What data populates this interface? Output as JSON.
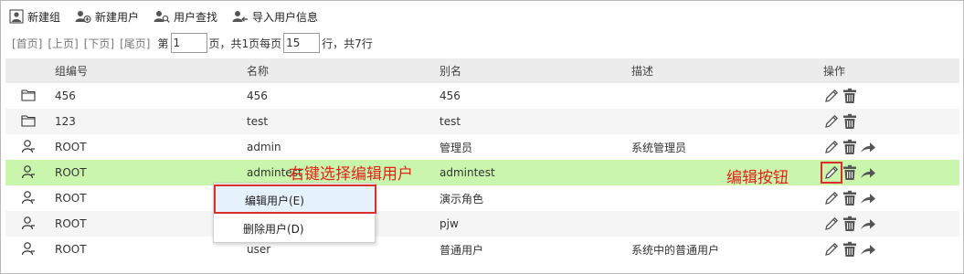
{
  "toolbar": {
    "new_group": "新建组",
    "new_user": "新建用户",
    "search_user": "用户查找",
    "import_user": "导入用户信息"
  },
  "pager": {
    "first": "[首页]",
    "prev": "[上页]",
    "next": "[下页]",
    "last": "[尾页]",
    "page_prefix": "第",
    "page_value": "1",
    "page_suffix": "页，共1页每页",
    "per_page_value": "15",
    "total_text": "行，共7行"
  },
  "table": {
    "headers": [
      "组编号",
      "名称",
      "别名",
      "描述",
      "操作"
    ],
    "rows": [
      {
        "type": "group",
        "id": "456",
        "name": "456",
        "alias": "456",
        "desc": ""
      },
      {
        "type": "group",
        "id": "123",
        "name": "test",
        "alias": "test",
        "desc": ""
      },
      {
        "type": "user",
        "id": "ROOT",
        "name": "admin",
        "alias": "管理员",
        "desc": "系统管理员"
      },
      {
        "type": "user",
        "id": "ROOT",
        "name": "admintest",
        "alias": "admintest",
        "desc": ""
      },
      {
        "type": "user",
        "id": "ROOT",
        "name": "",
        "alias": "演示角色",
        "desc": ""
      },
      {
        "type": "user",
        "id": "ROOT",
        "name": "",
        "alias": "pjw",
        "desc": ""
      },
      {
        "type": "user",
        "id": "ROOT",
        "name": "user",
        "alias": "普通用户",
        "desc": "系统中的普通用户"
      }
    ]
  },
  "context_menu": {
    "edit_user": "编辑用户(E)",
    "delete_user": "删除用户(D)"
  },
  "annotations": {
    "right_click": "右键选择编辑用户",
    "edit_button": "编辑按钮"
  },
  "colors": {
    "selected_row": "#c9f5ad",
    "annotation": "#e2231a",
    "menu_highlight": "#e5f1fb"
  }
}
